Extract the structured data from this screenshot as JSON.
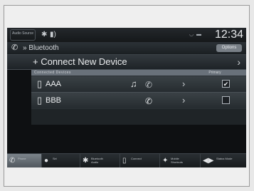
{
  "status_bar": {
    "audio_source_label": "Audio Source",
    "clock": "12:34"
  },
  "header": {
    "title": "Bluetooth",
    "options_label": "Options"
  },
  "connect": {
    "label": "+ Connect New Device"
  },
  "device_list": {
    "header_left": "Connected Devices",
    "header_right": "Primary",
    "devices": [
      {
        "name": "AAA",
        "audio": true,
        "phone": true,
        "primary": true
      },
      {
        "name": "BBB",
        "audio": false,
        "phone": true,
        "primary": false
      }
    ]
  },
  "nav": {
    "items": [
      {
        "label": "Phone",
        "icon": "phone-icon",
        "active": true
      },
      {
        "label": "Siri",
        "icon": "voice-icon",
        "active": false
      },
      {
        "label": "Bluetooth Audio",
        "icon": "bluetooth-icon",
        "active": false
      },
      {
        "label": "Connect",
        "icon": "device-icon",
        "active": false
      },
      {
        "label": "Mobile Shortcuts",
        "icon": "shortcut-icon",
        "active": false
      },
      {
        "label": "Status Mode",
        "icon": "status-icon",
        "active": false
      }
    ]
  }
}
